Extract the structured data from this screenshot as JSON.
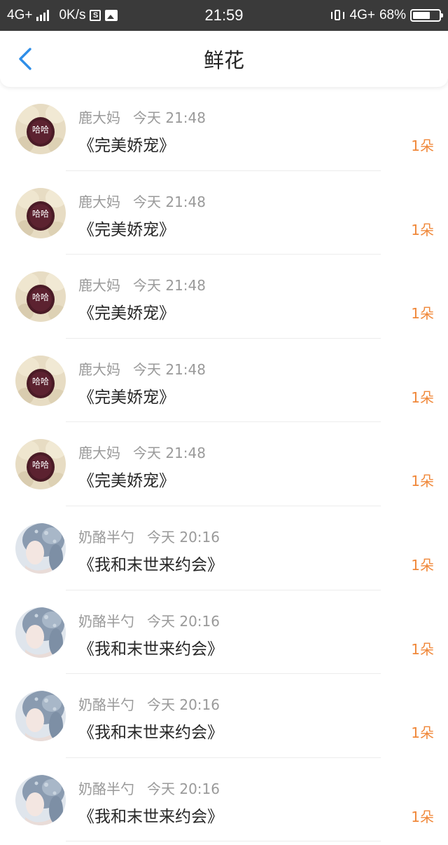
{
  "status_bar": {
    "network": "4G+",
    "speed": "0K/s",
    "time": "21:59",
    "network_right": "4G+",
    "battery": "68%",
    "battery_level": 0.68,
    "icons": [
      "signal-icon",
      "s-app-icon",
      "image-icon",
      "vibrate-icon",
      "battery-icon"
    ]
  },
  "header": {
    "back_icon": "chevron-left-icon",
    "title": "鲜花",
    "accent_color": "#2e8ee8"
  },
  "colors": {
    "amount": "#f0883a",
    "meta": "#9a9a9a",
    "book": "#262626"
  },
  "records": [
    {
      "avatar": "hamster-avatar",
      "avatar_text": "哈哈",
      "user": "鹿大妈",
      "time": "今天 21:48",
      "book": "《完美娇宠》",
      "amount": "1朵"
    },
    {
      "avatar": "hamster-avatar",
      "avatar_text": "哈哈",
      "user": "鹿大妈",
      "time": "今天 21:48",
      "book": "《完美娇宠》",
      "amount": "1朵"
    },
    {
      "avatar": "hamster-avatar",
      "avatar_text": "哈哈",
      "user": "鹿大妈",
      "time": "今天 21:48",
      "book": "《完美娇宠》",
      "amount": "1朵"
    },
    {
      "avatar": "hamster-avatar",
      "avatar_text": "哈哈",
      "user": "鹿大妈",
      "time": "今天 21:48",
      "book": "《完美娇宠》",
      "amount": "1朵"
    },
    {
      "avatar": "hamster-avatar",
      "avatar_text": "哈哈",
      "user": "鹿大妈",
      "time": "今天 21:48",
      "book": "《完美娇宠》",
      "amount": "1朵"
    },
    {
      "avatar": "girl-avatar",
      "avatar_text": "",
      "user": "奶酪半勺",
      "time": "今天 20:16",
      "book": "《我和末世来约会》",
      "amount": "1朵"
    },
    {
      "avatar": "girl-avatar",
      "avatar_text": "",
      "user": "奶酪半勺",
      "time": "今天 20:16",
      "book": "《我和末世来约会》",
      "amount": "1朵"
    },
    {
      "avatar": "girl-avatar",
      "avatar_text": "",
      "user": "奶酪半勺",
      "time": "今天 20:16",
      "book": "《我和末世来约会》",
      "amount": "1朵"
    },
    {
      "avatar": "girl-avatar",
      "avatar_text": "",
      "user": "奶酪半勺",
      "time": "今天 20:16",
      "book": "《我和末世来约会》",
      "amount": "1朵"
    }
  ]
}
